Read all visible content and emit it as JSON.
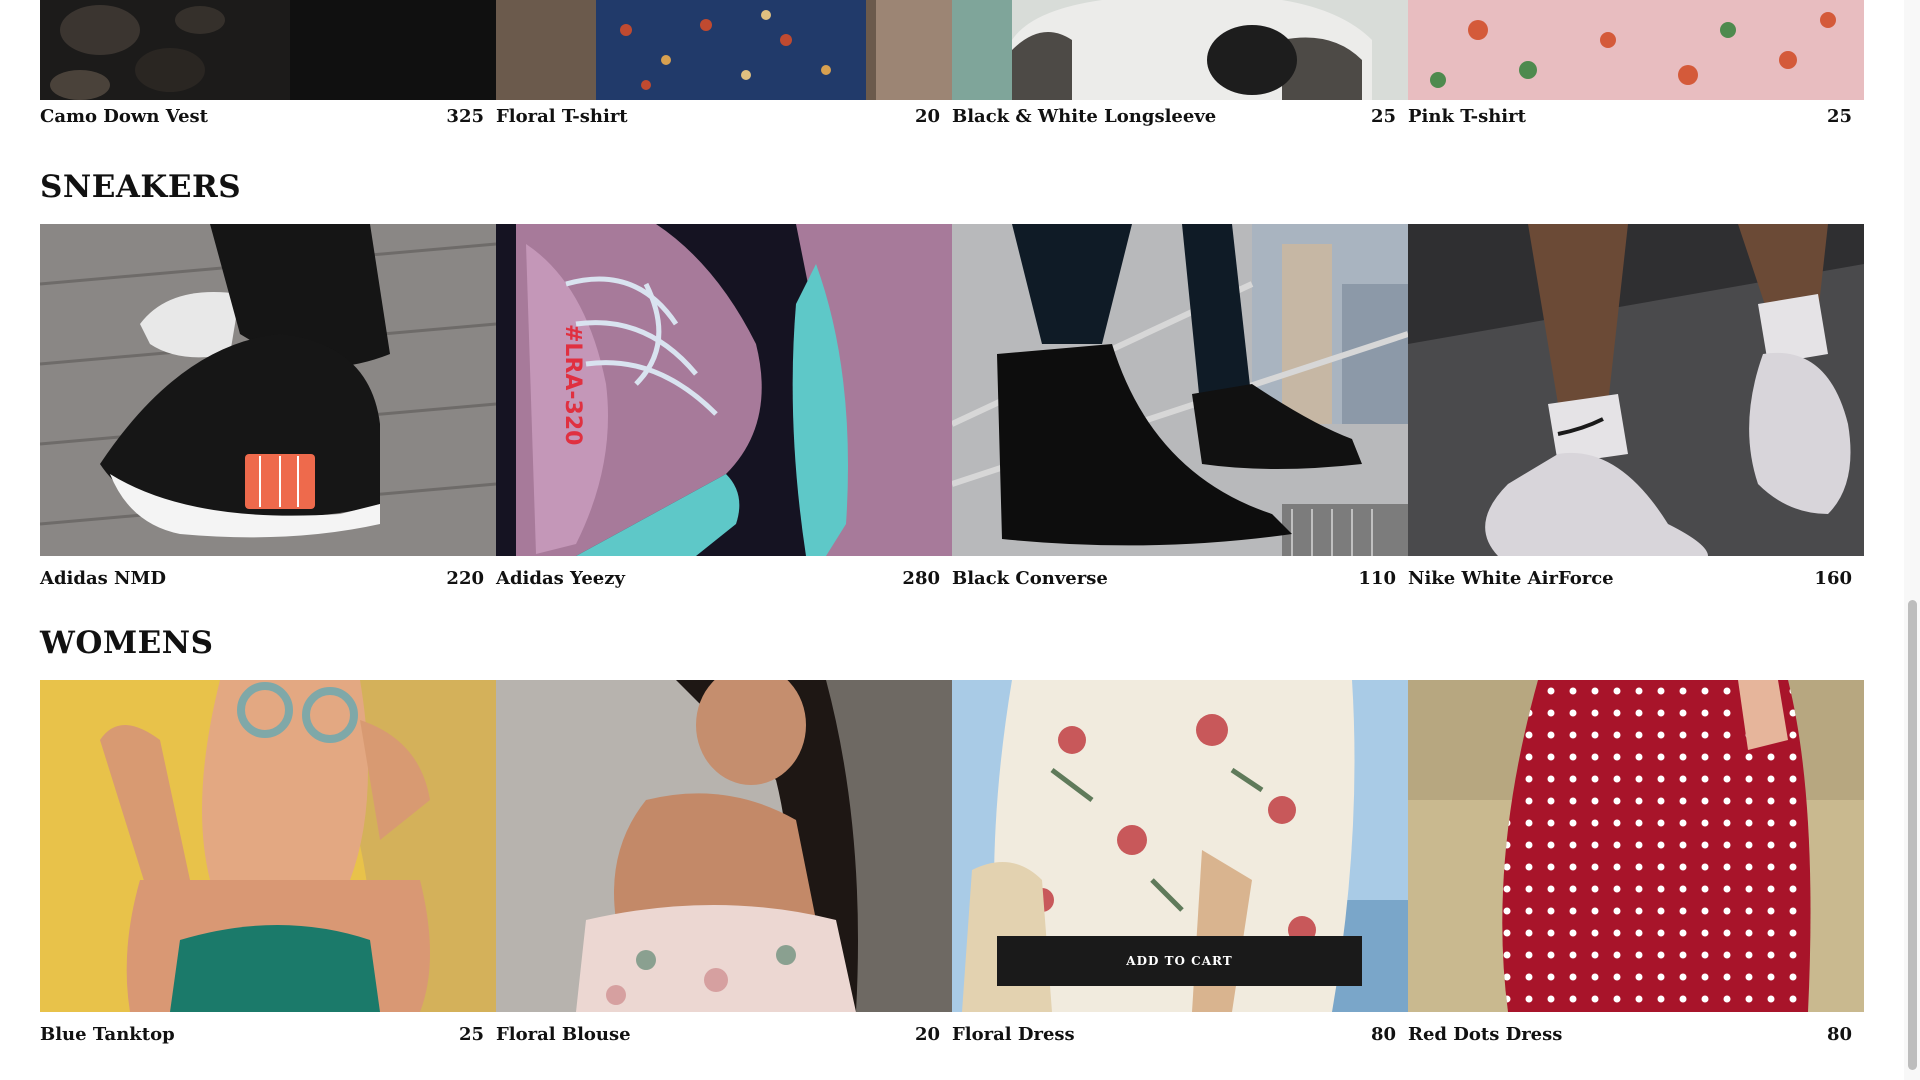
{
  "sections": [
    {
      "title": "",
      "items": [
        {
          "name": "Camo Down Vest",
          "price": "325"
        },
        {
          "name": "Floral T-shirt",
          "price": "20"
        },
        {
          "name": "Black & White Longsleeve",
          "price": "25"
        },
        {
          "name": "Pink T-shirt",
          "price": "25"
        }
      ]
    },
    {
      "title": "SNEAKERS",
      "items": [
        {
          "name": "Adidas NMD",
          "price": "220"
        },
        {
          "name": "Adidas Yeezy",
          "price": "280"
        },
        {
          "name": "Black Converse",
          "price": "110"
        },
        {
          "name": "Nike White AirForce",
          "price": "160"
        }
      ]
    },
    {
      "title": "WOMENS",
      "items": [
        {
          "name": "Blue Tanktop",
          "price": "25"
        },
        {
          "name": "Floral Blouse",
          "price": "20"
        },
        {
          "name": "Floral Dress",
          "price": "80"
        },
        {
          "name": "Red Dots Dress",
          "price": "80"
        }
      ]
    }
  ],
  "add_to_cart_label": "ADD TO CART"
}
